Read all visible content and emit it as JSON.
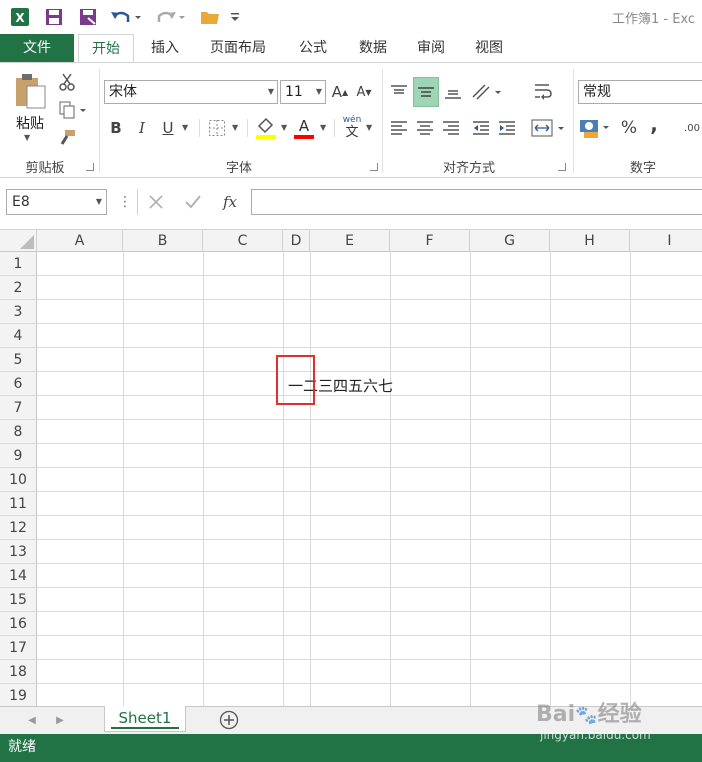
{
  "window": {
    "title": "工作簿1 - Exc"
  },
  "ribbon_tabs": [
    "文件",
    "开始",
    "插入",
    "页面布局",
    "公式",
    "数据",
    "审阅",
    "视图"
  ],
  "ribbon": {
    "clipboard": {
      "paste_label": "粘贴",
      "group_label": "剪贴板"
    },
    "font": {
      "name": "宋体",
      "size": "11",
      "group_label": "字体",
      "bold": "B",
      "italic": "I",
      "underline": "U",
      "grow": "A",
      "shrink": "A",
      "wen": "wén",
      "wen_char": "文"
    },
    "alignment": {
      "group_label": "对齐方式"
    },
    "number": {
      "format": "常规",
      "group_label": "数字",
      "percent": "%",
      "comma": ",",
      "decimal": ".00"
    }
  },
  "formula_bar": {
    "name_box": "E8",
    "fx": "fx",
    "value": ""
  },
  "grid": {
    "columns": [
      "A",
      "B",
      "C",
      "D",
      "E",
      "F",
      "G",
      "H",
      "I"
    ],
    "rows": [
      "1",
      "2",
      "3",
      "4",
      "5",
      "6",
      "7",
      "8",
      "9",
      "10",
      "11",
      "12",
      "13",
      "14",
      "15",
      "16",
      "17",
      "18",
      "19"
    ],
    "cell_d6": "一二三四五六七"
  },
  "sheets": {
    "active": "Sheet1",
    "add": "+"
  },
  "status": {
    "text": "就绪"
  },
  "watermark": {
    "main": "Bai",
    "main2": "经验",
    "sub": "jingyan.baidu.com"
  },
  "colors": {
    "excel_green": "#217346",
    "highlight_red": "#e0302b"
  }
}
